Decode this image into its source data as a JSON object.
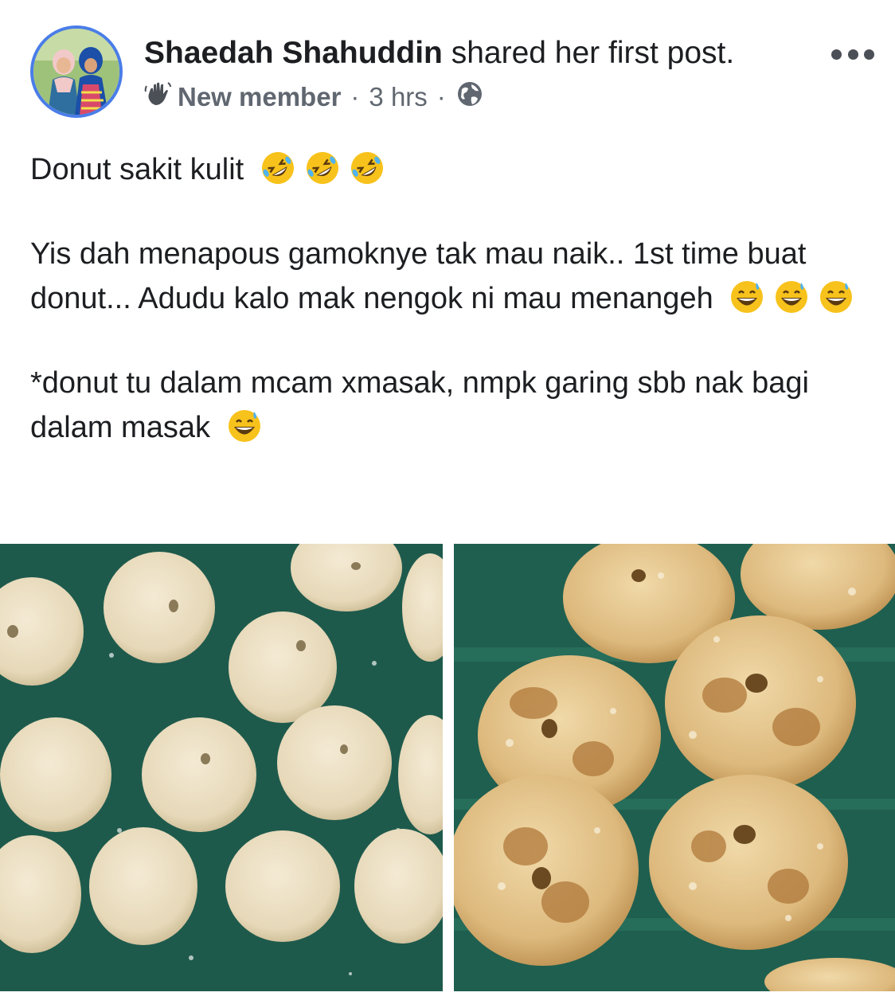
{
  "post": {
    "author_name": "Shaedah Shahuddin",
    "action_text": " shared her first post.",
    "badge_icon": "wave-hand-icon",
    "badge_label": "New member",
    "separator": "·",
    "time": "3 hrs",
    "privacy_icon": "globe-icon",
    "more_icon": "ellipsis-icon"
  },
  "content": {
    "line1": "Donut sakit kulit",
    "line1_emoji": "rolling-on-floor-laughing-emoji",
    "para2": "Yis dah menapous gamoknye tak mau naik.. 1st time buat donut... Adudu kalo mak nengok ni mau menangeh",
    "para2_emoji": "grinning-sweat-emoji",
    "para3": "*donut tu dalam mcam xmasak, nmpk garing sbb nak bagi dalam masak",
    "para3_emoji": "grinning-sweat-emoji"
  },
  "photos": [
    {
      "subject": "raw dough rings on floured green tray"
    },
    {
      "subject": "fried donuts on green tray"
    }
  ],
  "colors": {
    "avatar_ring": "#4a7de8",
    "meta_text": "#606770",
    "tray_green": "#1f5f4f",
    "dough": "#e8dcc0",
    "fried": "#dcb67a"
  }
}
